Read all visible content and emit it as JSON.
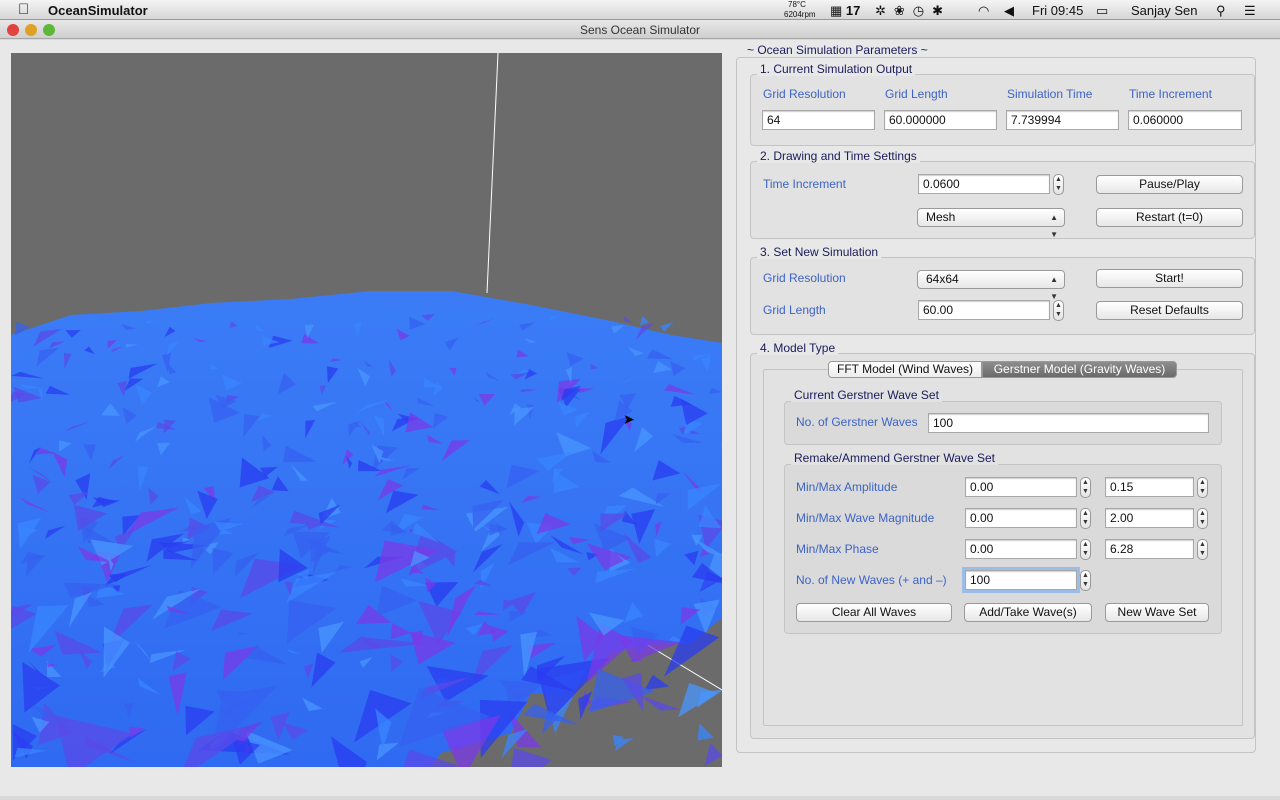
{
  "menubar": {
    "app_name": "OceanSimulator",
    "temp": "78°C",
    "rpm": "6204rpm",
    "calendar": "17",
    "clock": "Fri 09:45",
    "user": "Sanjay Sen"
  },
  "window": {
    "title": "Sens Ocean Simulator"
  },
  "panel": {
    "title": "~ Ocean Simulation Parameters ~",
    "output": {
      "title": "1.   Current Simulation Output",
      "labels": [
        "Grid Resolution",
        "Grid Length",
        "Simulation Time",
        "Time Increment"
      ],
      "values": [
        "64",
        "60.000000",
        "7.739994",
        "0.060000"
      ]
    },
    "drawing": {
      "title": "2.   Drawing and Time Settings",
      "time_increment_label": "Time Increment",
      "time_increment": "0.0600",
      "draw_mode": "Mesh",
      "pause_play": "Pause/Play",
      "restart": "Restart (t=0)"
    },
    "new_sim": {
      "title": "3.   Set New Simulation",
      "grid_resolution_label": "Grid Resolution",
      "grid_resolution": "64x64",
      "grid_length_label": "Grid Length",
      "grid_length": "60.00",
      "start": "Start!",
      "reset": "Reset Defaults"
    },
    "model": {
      "title": "4.   Model Type",
      "tabs": [
        "FFT Model (Wind Waves)",
        "Gerstner Model (Gravity Waves)"
      ],
      "active_tab": 1,
      "current": {
        "title": "Current Gerstner Wave Set",
        "count_label": "No. of Gerstner Waves",
        "count": "100"
      },
      "remake": {
        "title": "Remake/Ammend Gerstner Wave Set",
        "amplitude_label": "Min/Max Amplitude",
        "amp_min": "0.00",
        "amp_max": "0.15",
        "magnitude_label": "Min/Max Wave Magnitude",
        "mag_min": "0.00",
        "mag_max": "2.00",
        "phase_label": "Min/Max Phase",
        "phase_min": "0.00",
        "phase_max": "6.28",
        "new_waves_label": "No. of New Waves (+ and –)",
        "new_waves": "100",
        "clear": "Clear All Waves",
        "add_take": "Add/Take Wave(s)",
        "new_set": "New Wave Set"
      }
    }
  },
  "colors": {
    "ocean_light": "#3a86ff",
    "ocean_dark": "#2a3cf0",
    "ocean_purple": "#7a3ae8",
    "background": "#6b6b6b"
  }
}
